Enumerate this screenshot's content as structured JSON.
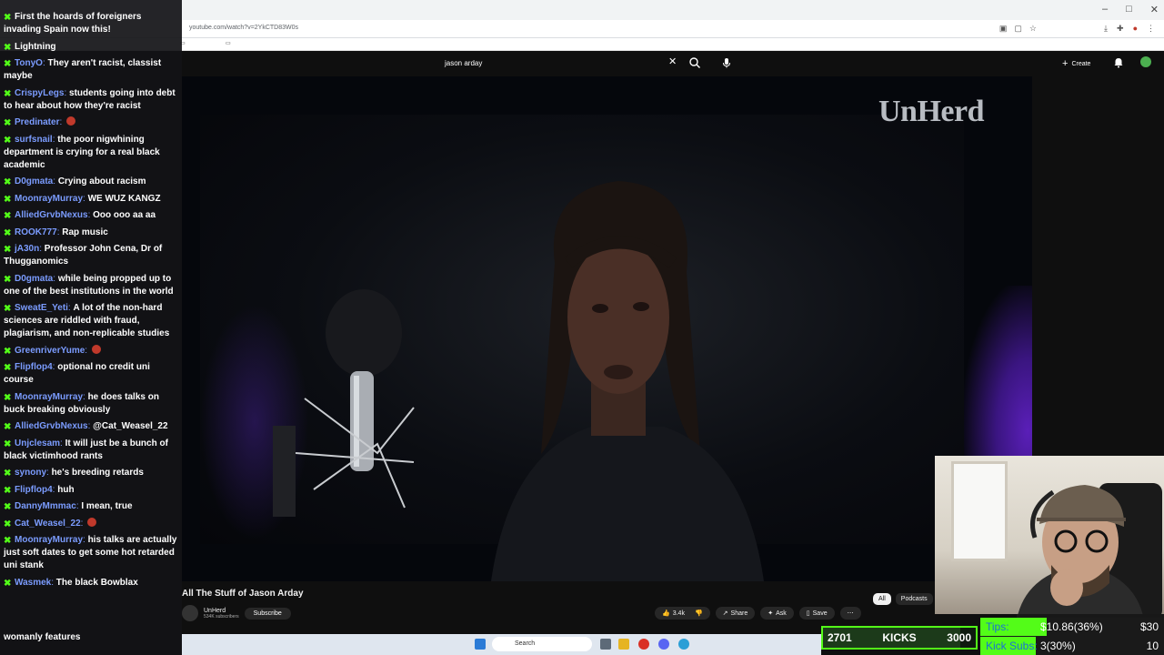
{
  "browser": {
    "url": "youtube.com/watch?v=2YkCTD83W0s",
    "window_controls": [
      "–",
      "□",
      "✕"
    ]
  },
  "youtube": {
    "search_query": "jason arday",
    "create_label": "Create",
    "logo_text": "UnHerd",
    "video_title": "All The Stuff of Jason Arday",
    "channel_name": "UnHerd",
    "channel_subs": "534K subscribers",
    "subscribe_label": "Subscribe",
    "like_count": "3.4k",
    "share_label": "Share",
    "ask_label": "Ask",
    "save_label": "Save",
    "chips": [
      "All",
      "Podcasts"
    ]
  },
  "chat": {
    "messages": [
      {
        "user": "",
        "text": "First the hoards of foreigners invading Spain now this!"
      },
      {
        "user": "",
        "text": "Lightning"
      },
      {
        "user": "TonyO",
        "text": "They aren't racist, classist maybe"
      },
      {
        "user": "CrispyLegs",
        "text": "students going into debt to hear about how they're racist"
      },
      {
        "user": "Predinater",
        "text": ""
      },
      {
        "user": "surfsnail",
        "text": "the poor nigwhining department is crying for a real black academic"
      },
      {
        "user": "D0gmata",
        "text": "Crying about racism"
      },
      {
        "user": "MoonrayMurray",
        "text": "WE WUZ KANGZ"
      },
      {
        "user": "AlliedGrvbNexus",
        "text": "Ooo ooo aa aa"
      },
      {
        "user": "ROOK777",
        "text": "Rap music"
      },
      {
        "user": "jA30n",
        "text": "Professor John Cena, Dr of Thugganomics"
      },
      {
        "user": "D0gmata",
        "text": "while being propped up to one of the best institutions in the world"
      },
      {
        "user": "SweatE_Yeti",
        "text": "A lot of the non-hard sciences are riddled with fraud, plagiarism, and non-replicable studies"
      },
      {
        "user": "GreenriverYume",
        "text": ""
      },
      {
        "user": "Flipflop4",
        "text": "optional no credit uni course"
      },
      {
        "user": "MoonrayMurray",
        "text": "he does talks on buck breaking obviously"
      },
      {
        "user": "AlliedGrvbNexus",
        "text": "@Cat_Weasel_22"
      },
      {
        "user": "Unjclesam",
        "text": "It will just be a bunch of black victimhood rants"
      },
      {
        "user": "synony",
        "text": "he's breeding retards"
      },
      {
        "user": "Flipflop4",
        "text": "huh"
      },
      {
        "user": "DannyMmmac",
        "text": "I mean, true"
      },
      {
        "user": "Cat_Weasel_22",
        "text": ""
      },
      {
        "user": "MoonrayMurray",
        "text": "his talks are actually just soft dates to get some hot retarded uni stank"
      },
      {
        "user": "Wasmek",
        "text": "The black Bowblax"
      }
    ],
    "bottom_text": "womanly features"
  },
  "stats": {
    "kicks_current": "2701",
    "kicks_label": "KICKS",
    "kicks_target": "3000",
    "kicks_progress": 0.9,
    "tips_label": "Tips:",
    "tips_value": "$10.86(36%)",
    "tips_target": "$30",
    "tips_progress": 0.36,
    "subs_label": "Kick Subs:",
    "subs_value": "3(30%)",
    "subs_target": "10",
    "subs_progress": 0.3
  },
  "taskbar": {
    "search_label": "Search"
  },
  "colors": {
    "kick_green": "#53fc18",
    "chat_user": "#7b9cff",
    "youtube_bg": "#0f0f0f"
  }
}
